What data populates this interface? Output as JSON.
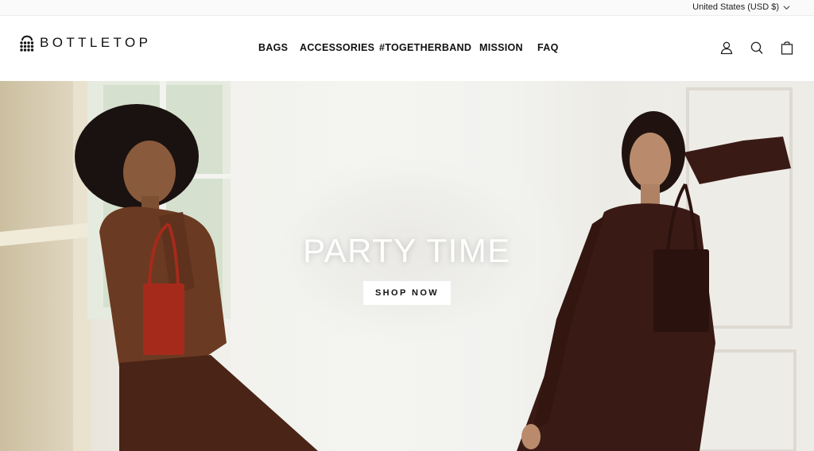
{
  "utility": {
    "currency_label": "United States (USD $)"
  },
  "header": {
    "brand": "BOTTLETOP",
    "nav": [
      {
        "label": "BAGS"
      },
      {
        "label": "ACCESSORIES"
      },
      {
        "label": "#TOGETHERBAND"
      },
      {
        "label": "MISSION"
      },
      {
        "label": "FAQ"
      }
    ],
    "icons": [
      "account-icon",
      "search-icon",
      "cart-icon"
    ]
  },
  "hero": {
    "title": "PARTY TIME",
    "cta_label": "SHOP NOW"
  },
  "colors": {
    "text": "#111111",
    "background": "#ffffff",
    "left_outfit": "#6b3a22",
    "right_outfit": "#3a1a15",
    "red_bag": "#a62a1c"
  }
}
